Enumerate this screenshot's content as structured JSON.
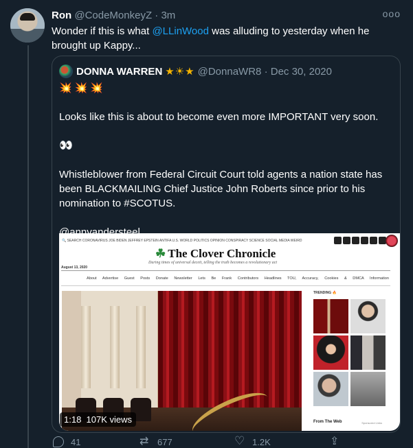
{
  "tweet": {
    "author_name": "Ron",
    "author_handle": "@CodeMonkeyZ",
    "separator": "·",
    "time": "3m",
    "more_icon": "ooo",
    "text_before": "Wonder if this is what ",
    "mention": "@LLinWood",
    "text_after": " was alluding to yesterday when he brought up Kappy..."
  },
  "quote": {
    "author_name": "DONNA WARREN",
    "stars": "★☀★",
    "handle": "@DonnaWR8",
    "separator": "·",
    "date": "Dec 30, 2020",
    "bursts": "💥💥💥",
    "line1": "Looks like this is about to become even more IMPORTANT very soon.",
    "eyes": "👀",
    "line2": "Whistleblower from Federal Circuit Court told agents a nation state has been BLACKMAILING Chief Justice John Roberts since prior to his nomination to #SCOTUS.",
    "line3": "@annvandersteel"
  },
  "media": {
    "top_nav": "🔍 SEARCH   CORONAVIRUS  JOE BIDEN  JEFFREY EPSTEIN  ANTIFA  U.S.  WORLD  POLITICS  OPINION  CONSPIRACY  SCIENCE  SOCIAL MEDIA  WEIRD",
    "site_logo": "The Clover Chronicle",
    "tagline": "During times of universal deceit, telling the truth becomes a revolutionary act",
    "date": "August 13, 2020",
    "nav": "About  Advertise  Guest Posts  Donate  Newsletter  Lets Be Frank  Contributors  Headlines  TOU, Accuracy, Cookies & DMCA Information",
    "trending": "TRENDING 🔥",
    "from_web": "From The Web",
    "sponsored": "Sponsored Links",
    "video_duration": "1:18",
    "video_views": "107K views"
  },
  "actions": {
    "replies": "41",
    "retweets": "677",
    "likes": "1.2K"
  },
  "colors": {
    "background": "#15202b",
    "link": "#1da1f2",
    "muted": "#8899a6",
    "border": "#38444d"
  }
}
